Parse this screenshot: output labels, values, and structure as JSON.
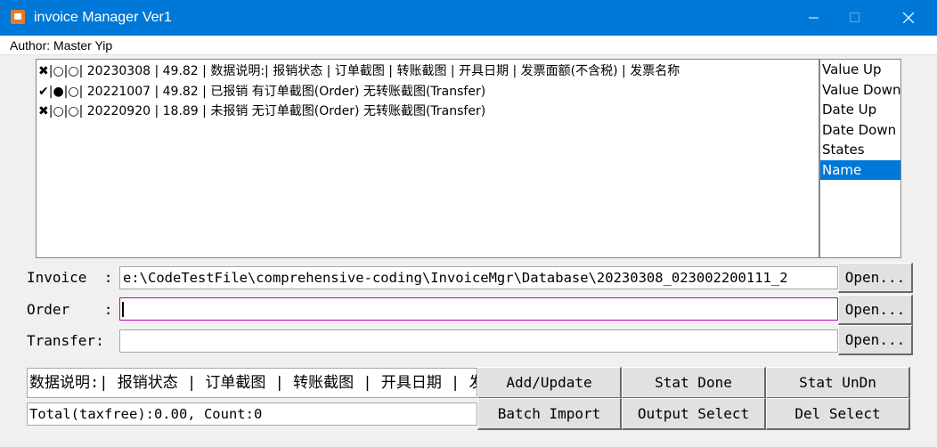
{
  "window": {
    "title": "invoice Manager Ver1",
    "accent": "#0078d7"
  },
  "menu": {
    "author": "Author: Master Yip"
  },
  "invoice_list": [
    "✖|○|○| 20230308 | 49.82    | 数据说明:| 报销状态 | 订单截图 | 转账截图 | 开具日期 | 发票面额(不含税) | 发票名称",
    "✔|●|○| 20221007 | 49.82    | 已报销 有订单截图(Order) 无转账截图(Transfer)",
    "✖|○|○| 20220920 | 18.89    | 未报销 无订单截图(Order) 无转账截图(Transfer)"
  ],
  "sort_options": [
    {
      "label": "Value Up",
      "selected": false
    },
    {
      "label": "Value Down",
      "selected": false
    },
    {
      "label": "Date Up",
      "selected": false
    },
    {
      "label": "Date Down",
      "selected": false
    },
    {
      "label": "States",
      "selected": false
    },
    {
      "label": "Name",
      "selected": true
    }
  ],
  "fields": {
    "invoice": {
      "label": "Invoice  :",
      "value": "e:\\CodeTestFile\\comprehensive-coding\\InvoiceMgr\\Database\\20230308_023002200111_2"
    },
    "order": {
      "label": "Order    :",
      "value": ""
    },
    "transfer": {
      "label": "Transfer:",
      "value": ""
    },
    "open_label": "Open..."
  },
  "description": "数据说明:| 报销状态 | 订单截图 | 转账截图 | 开具日期 | 发票面额(不含税) | 发票名称",
  "total": "Total(taxfree):0.00, Count:0",
  "buttons": {
    "add_update": "Add/Update",
    "stat_done": "Stat Done",
    "stat_undn": "Stat UnDn",
    "batch_import": "Batch Import",
    "output_select": "Output Select",
    "del_select": "Del Select"
  }
}
